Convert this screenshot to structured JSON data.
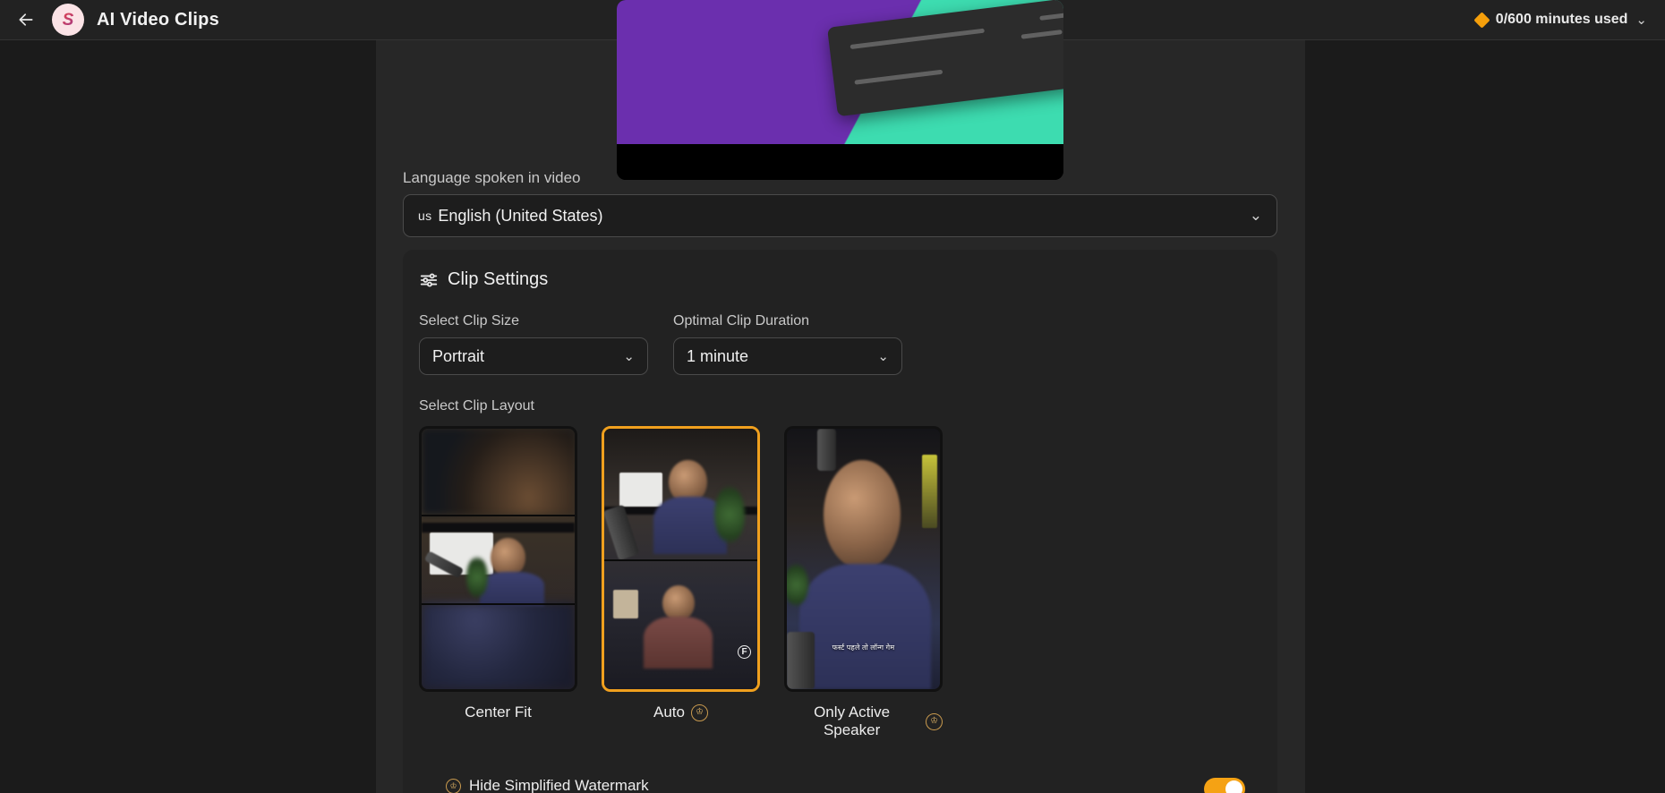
{
  "topbar": {
    "back_icon": "arrow-left-icon",
    "logo_mark": "S",
    "title": "AI Video Clips",
    "credits_icon": "diamond-icon",
    "credits_text": "0/600 minutes used",
    "credits_chevron": "⌄"
  },
  "language": {
    "label": "Language spoken in video",
    "flag_code": "us",
    "value": "English (United States)",
    "chevron": "⌄"
  },
  "clip_settings": {
    "icon": "sliders-icon",
    "title": "Clip Settings",
    "clip_size": {
      "label": "Select Clip Size",
      "value": "Portrait",
      "chevron": "⌄"
    },
    "clip_duration": {
      "label": "Optimal Clip Duration",
      "value": "1 minute",
      "chevron": "⌄"
    },
    "layout": {
      "label": "Select Clip Layout",
      "options": [
        {
          "label": "Center Fit",
          "premium": false,
          "selected": false
        },
        {
          "label": "Auto",
          "premium": true,
          "selected": true
        },
        {
          "label": "Only Active Speaker",
          "premium": true,
          "selected": false
        }
      ],
      "premium_badge_icon": "crown-icon",
      "subtitle_text": "फर्स्ट पहले तो लॉन्ग गेम"
    },
    "watermark": {
      "icon": "crown-icon",
      "label": "Hide Simplified Watermark",
      "toggle_on": true
    }
  },
  "colors": {
    "accent": "#f0a01e",
    "toggle_on": "#f5a214",
    "premium": "#c99a4e",
    "panel": "#272727",
    "card": "#222222",
    "page_bg": "#1b1b1b",
    "input_bg": "#1d1d1d",
    "preview_purple": "#6b2fae",
    "preview_teal": "#3ddcb0"
  }
}
